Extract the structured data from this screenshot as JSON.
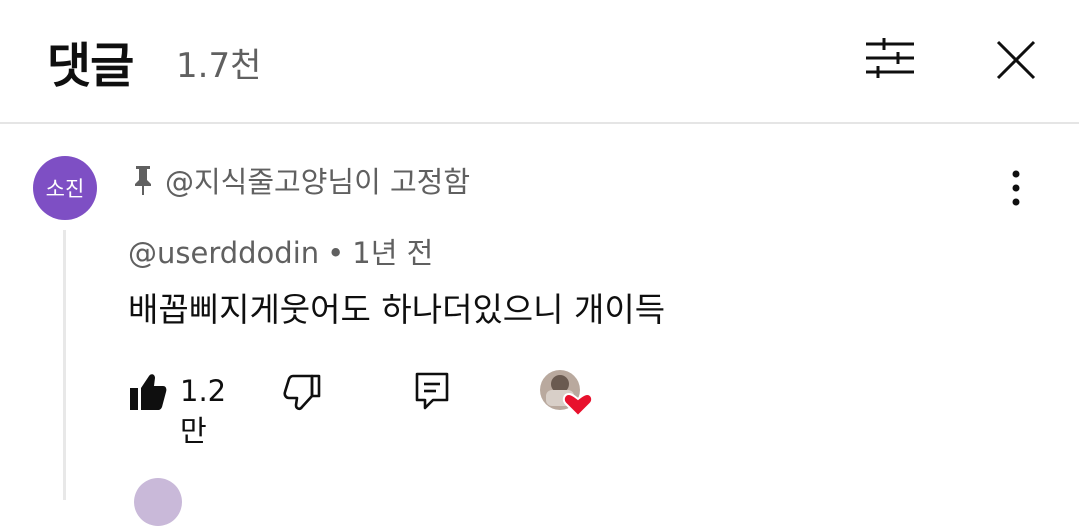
{
  "header": {
    "title": "댓글",
    "count": "1.7천"
  },
  "comment": {
    "avatar_text": "소진",
    "avatar_color": "#7e4fc4",
    "pinned_text": "@지식줄고양님이 고정함",
    "author": "@userddodin",
    "separator": "•",
    "time": "1년 전",
    "text": "배꼽삐지게웃어도 하나더있으니 개이득",
    "like_count": "1.2만",
    "heart_color": "#e8112d"
  },
  "icons": {
    "filter": "sliders-icon",
    "close": "close-icon",
    "pin": "pin-icon",
    "more": "more-vertical-icon",
    "like": "thumb-up-filled-icon",
    "dislike": "thumb-down-icon",
    "reply": "reply-icon"
  }
}
